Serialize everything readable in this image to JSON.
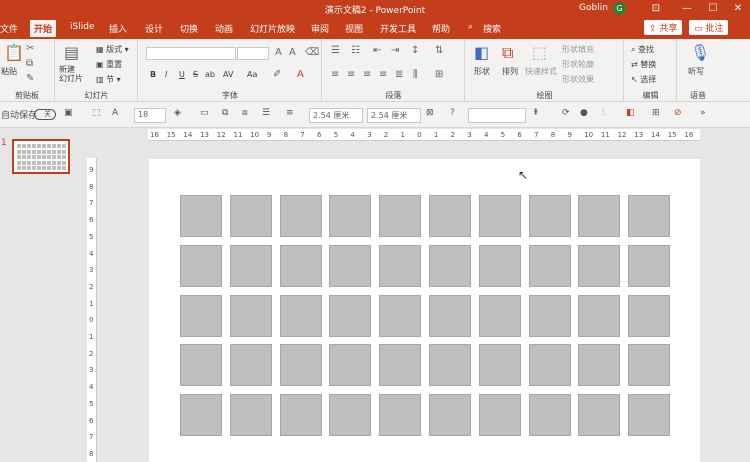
{
  "window": {
    "title": "演示文稿2  -  PowerPoint",
    "user": "Goblin",
    "avatar_initial": "G",
    "controls": [
      "⊡",
      "—",
      "☐",
      "✕"
    ]
  },
  "tabs": [
    "文件",
    "开始",
    "iSlide",
    "插入",
    "设计",
    "切换",
    "动画",
    "幻灯片放映",
    "审阅",
    "视图",
    "开发工具",
    "帮助",
    "搜索"
  ],
  "active_tab": "开始",
  "share_label": "共享",
  "comment_label": "批注",
  "ribbon": {
    "clipboard": {
      "paste": "粘贴",
      "cut_icon": "cut-icon",
      "copy_icon": "copy-icon",
      "label": "剪贴板"
    },
    "slides": {
      "new_slide": "新建\n幻灯片",
      "layout": "版式",
      "reset": "重置",
      "section": "节",
      "label": "幻灯片"
    },
    "font": {
      "font_name": "",
      "font_size": "",
      "bold": "B",
      "italic": "I",
      "underline": "U",
      "strike": "S",
      "shadow": "ab",
      "spacing": "AV",
      "case": "Aa",
      "label": "字体"
    },
    "paragraph": {
      "label": "段落"
    },
    "drawing": {
      "shape": "形状",
      "arrange": "排列",
      "quick_styles": "快速样式",
      "fill": "形状填充",
      "outline": "形状轮廓",
      "effects": "形状效果",
      "label": "绘图"
    },
    "editing": {
      "find": "查找",
      "replace": "替换",
      "select": "选择",
      "label": "编辑"
    },
    "voice": {
      "dictate": "听写",
      "label": "语音"
    }
  },
  "toolbar2": {
    "autosave": "自动保存",
    "autosave_state": "关",
    "font_size": "18",
    "width": "2.54 厘米",
    "height": "2.54 厘米"
  },
  "thumbnail": {
    "number": "1"
  },
  "ruler": {
    "h_ticks": [
      "16",
      "15",
      "14",
      "13",
      "12",
      "11",
      "10",
      "9",
      "8",
      "7",
      "6",
      "5",
      "4",
      "3",
      "2",
      "1",
      "0",
      "1",
      "2",
      "3",
      "4",
      "5",
      "6",
      "7",
      "8",
      "9",
      "10",
      "11",
      "12",
      "13",
      "14",
      "15",
      "16"
    ],
    "v_ticks": [
      "9",
      "8",
      "7",
      "6",
      "5",
      "4",
      "3",
      "2",
      "1",
      "0",
      "1",
      "2",
      "3",
      "4",
      "5",
      "6",
      "7",
      "8"
    ]
  },
  "grid": {
    "rows": 5,
    "cols": 10,
    "fill": "#bfbfbf",
    "border": "#a6a6a6"
  }
}
